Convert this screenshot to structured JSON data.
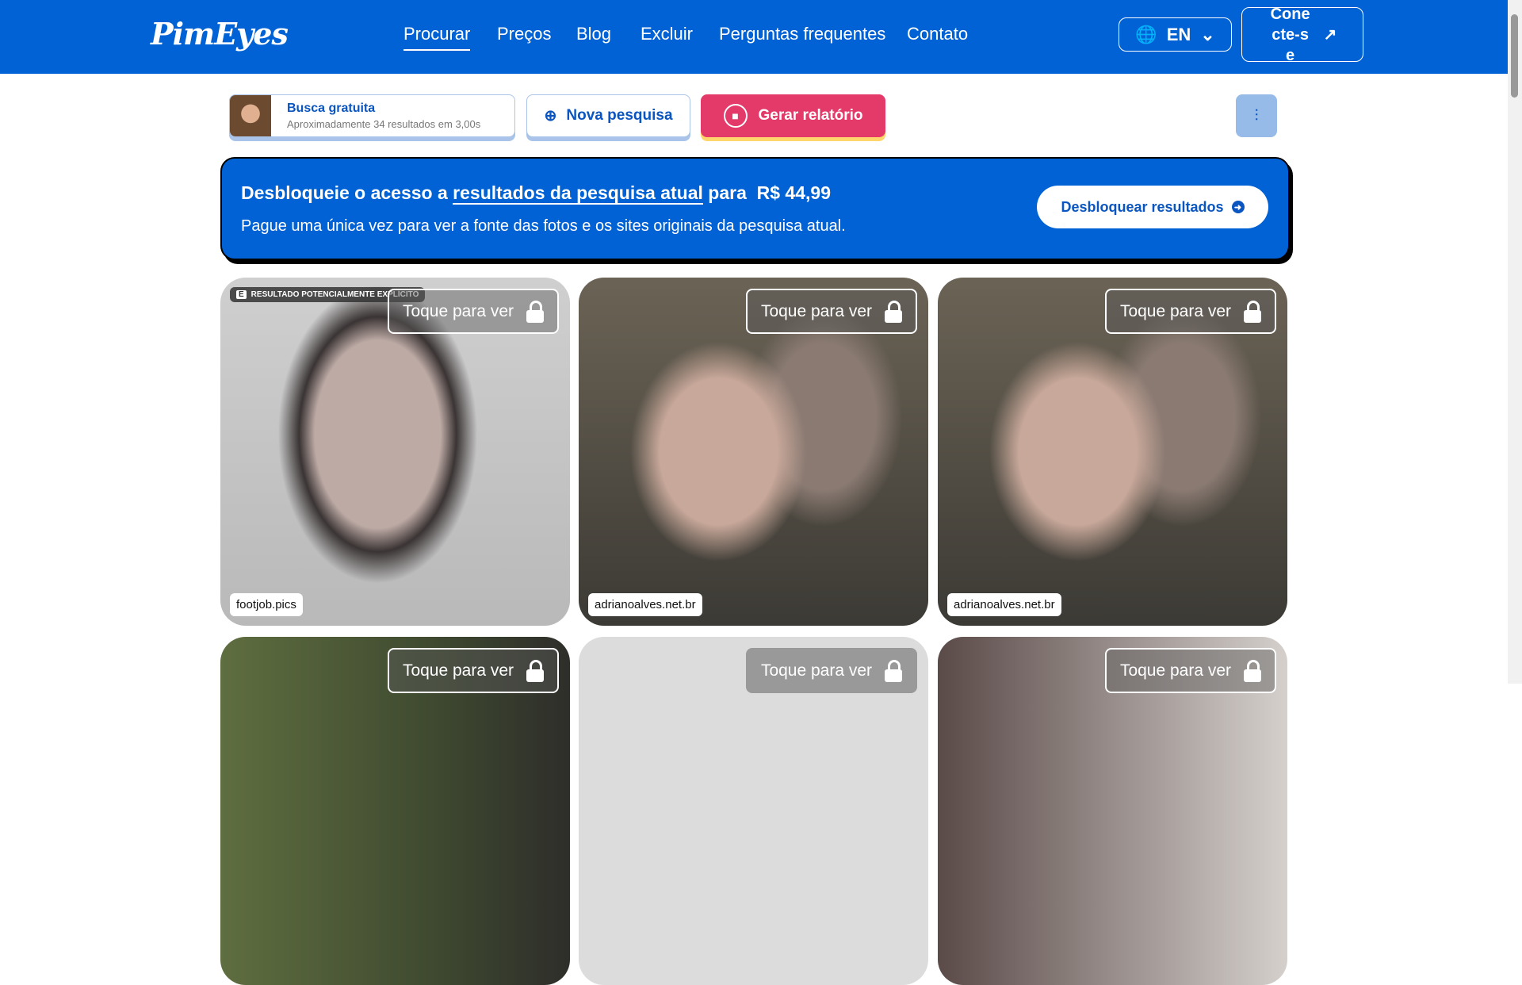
{
  "header": {
    "logo": "PimEyes",
    "nav": [
      "Procurar",
      "Preços",
      "Blog",
      "Excluir",
      "Perguntas frequentes",
      "Contato"
    ],
    "lang": "EN",
    "login": "Conecte-se"
  },
  "toolbar": {
    "busca_title": "Busca gratuita",
    "busca_sub": "Aproximadamente 34 resultados em 3,00s",
    "nova": "Nova pesquisa",
    "gerar": "Gerar relatório"
  },
  "banner": {
    "pre": "Desbloqueie o acesso a ",
    "link": "resultados da pesquisa atual",
    "mid": " para  R$ 44,99",
    "sub": "Pague uma única vez para ver a fonte das fotos e os sites originais da pesquisa atual.",
    "button": "Desbloquear resultados"
  },
  "results": {
    "tap": "Toque para ver",
    "explicit_badge": "E",
    "explicit": "RESULTADO POTENCIALMENTE EXPLÍCITO",
    "items": [
      {
        "domain": "footjob.pics"
      },
      {
        "domain": "adrianoalves.net.br"
      },
      {
        "domain": "adrianoalves.net.br"
      }
    ]
  }
}
